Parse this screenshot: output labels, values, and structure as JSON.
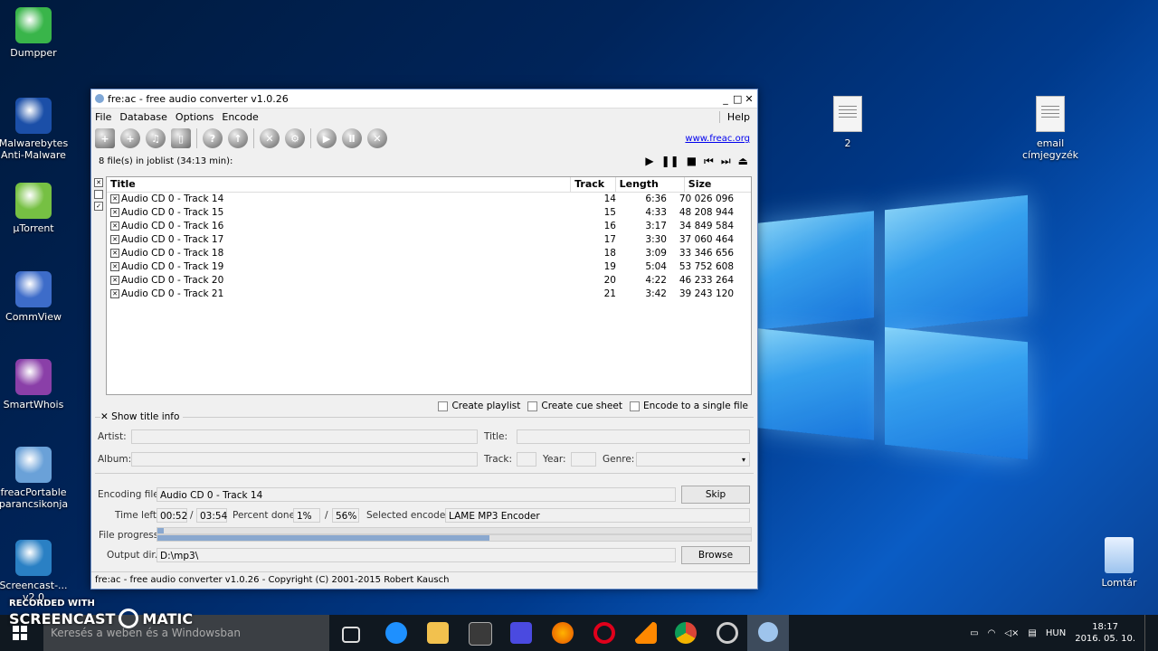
{
  "desktop": {
    "icons_left": [
      {
        "label": "Dumpper",
        "color": "#39b54a"
      },
      {
        "label": "Malwarebytes Anti-Malware",
        "color": "#1b4fa8"
      },
      {
        "label": "µTorrent",
        "color": "#76c043"
      },
      {
        "label": "CommView",
        "color": "#3d6cc9"
      },
      {
        "label": "SmartWhois",
        "color": "#8a3fa8"
      },
      {
        "label": "freacPortable parancsikonja",
        "color": "#6aa1d8"
      },
      {
        "label": "Screencast-... v2.0",
        "color": "#2a80c4"
      }
    ],
    "icons_right": [
      {
        "label": "2"
      },
      {
        "label": "email címjegyzék"
      },
      {
        "label": "Lomtár"
      }
    ]
  },
  "window": {
    "title": "fre:ac - free audio converter v1.0.26",
    "menu": [
      "File",
      "Database",
      "Options",
      "Encode"
    ],
    "help": "Help",
    "website": "www.freac.org",
    "jobinfo": "8 file(s) in joblist (34:13 min):",
    "columns": [
      "Title",
      "Track",
      "Length",
      "Size"
    ],
    "tracks": [
      {
        "title": "Audio CD 0 - Track 14",
        "track": "14",
        "length": "6:36",
        "size": "70 026 096"
      },
      {
        "title": "Audio CD 0 - Track 15",
        "track": "15",
        "length": "4:33",
        "size": "48 208 944"
      },
      {
        "title": "Audio CD 0 - Track 16",
        "track": "16",
        "length": "3:17",
        "size": "34 849 584"
      },
      {
        "title": "Audio CD 0 - Track 17",
        "track": "17",
        "length": "3:30",
        "size": "37 060 464"
      },
      {
        "title": "Audio CD 0 - Track 18",
        "track": "18",
        "length": "3:09",
        "size": "33 346 656"
      },
      {
        "title": "Audio CD 0 - Track 19",
        "track": "19",
        "length": "5:04",
        "size": "53 752 608"
      },
      {
        "title": "Audio CD 0 - Track 20",
        "track": "20",
        "length": "4:22",
        "size": "46 233 264"
      },
      {
        "title": "Audio CD 0 - Track 21",
        "track": "21",
        "length": "3:42",
        "size": "39 243 120"
      }
    ],
    "options": {
      "playlist": "Create playlist",
      "cue": "Create cue sheet",
      "single": "Encode to a single file"
    },
    "show_title_info": "Show title info",
    "labels": {
      "artist": "Artist:",
      "title": "Title:",
      "album": "Album:",
      "track": "Track:",
      "year": "Year:",
      "genre": "Genre:"
    },
    "encoding": {
      "file_label": "Encoding file:",
      "file_value": "Audio CD 0 - Track 14",
      "skip": "Skip",
      "time_label": "Time left:",
      "time_left": "00:52",
      "time_sep": "/",
      "time_total": "03:54",
      "percent_label": "Percent done:",
      "percent_file": "1%",
      "percent_sep": "/",
      "percent_total": "56%",
      "encoder_label": "Selected encoder:",
      "encoder_value": "LAME MP3 Encoder",
      "progress_label": "File progress:",
      "file_progress": 0.01,
      "total_progress": 0.56,
      "output_label": "Output dir.:",
      "output_value": "D:\\mp3\\",
      "browse": "Browse"
    },
    "statusbar": "fre:ac - free audio converter v1.0.26 - Copyright (C) 2001-2015 Robert Kausch"
  },
  "taskbar": {
    "search_placeholder": "Keresés a weben és a Windowsban",
    "language": "HUN",
    "time": "18:17",
    "date": "2016. 05. 10."
  },
  "watermark": {
    "line1": "RECORDED WITH",
    "line2": "SCREENCAST",
    "line3": "MATIC"
  }
}
